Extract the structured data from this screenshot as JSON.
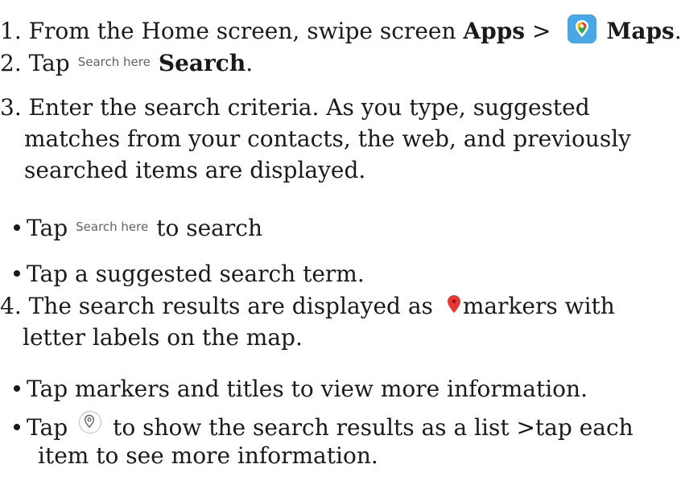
{
  "steps": {
    "step1": {
      "prefix": "1. From the Home screen, swipe screen ",
      "apps": "Apps",
      "gt": " > ",
      "maps": "Maps",
      "period": "."
    },
    "step2": {
      "prefix": "2. Tap",
      "search_ui": "Search here",
      "search": "Search",
      "period": "."
    },
    "step3": {
      "line1": "3. Enter the search criteria. As you type, suggested",
      "line2": "matches from your contacts, the web, and previously",
      "line3": "searched items are displayed."
    },
    "bullets3": [
      {
        "prefix": "Tap",
        "search_ui": "Search here",
        "suffix": "to search"
      },
      {
        "text": "Tap a suggested search term."
      }
    ],
    "step4": {
      "prefix": "4. The search results are displayed as ",
      "suffix": "markers with",
      "line2": "letter labels on the map."
    },
    "bullets4": [
      {
        "text": "Tap markers and titles to view more information."
      },
      {
        "prefix": "Tap",
        "suffix": "to show the search results as a list >tap each",
        "line2": "item to see more information."
      }
    ]
  },
  "colors": {
    "text": "#1a1a1a",
    "ui_gray": "#5f6368",
    "maps_blue": "#4aa7e6",
    "pin_red": "#e53935"
  },
  "icons": [
    "maps-app-icon",
    "map-pin-icon",
    "location-list-icon"
  ]
}
